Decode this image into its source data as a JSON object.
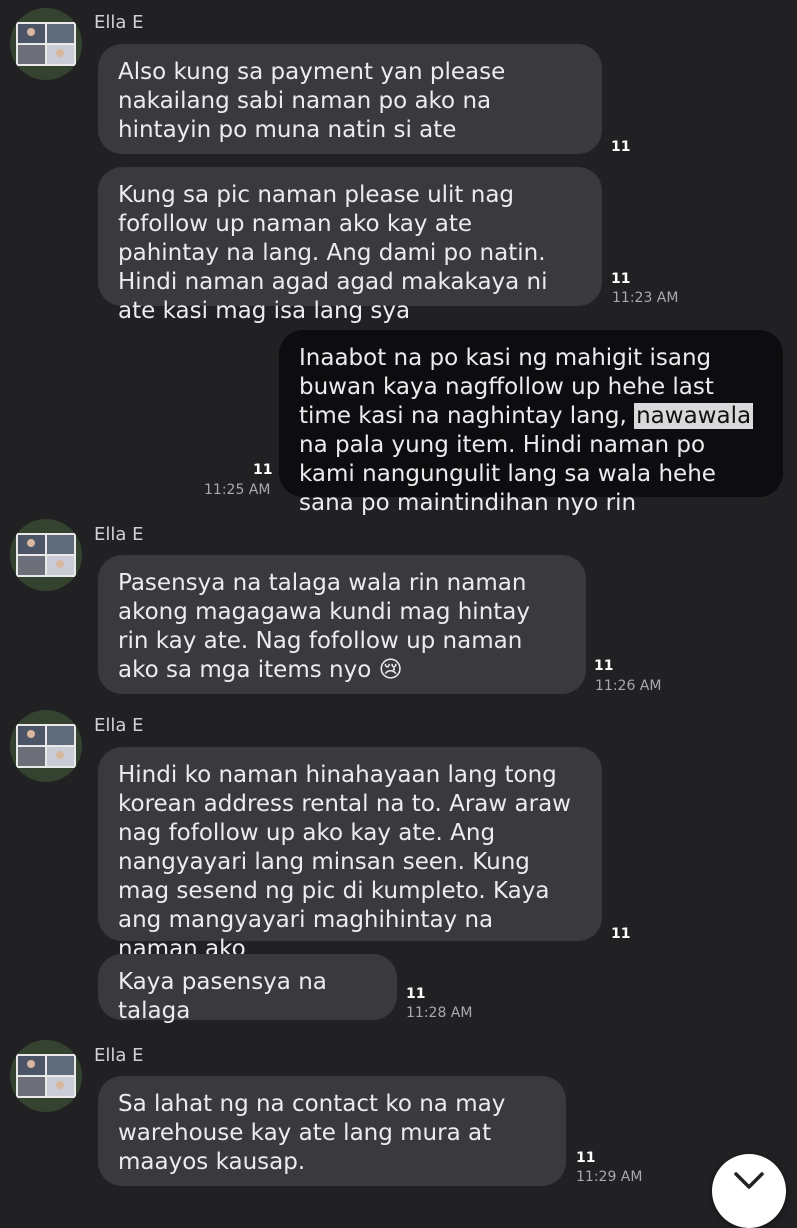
{
  "messages": [
    {
      "sender": "Ella E",
      "text": "Also kung sa payment yan please nakailang sabi naman po ako na hintayin po muna natin si ate",
      "unread": "11"
    },
    {
      "text": "Kung sa pic naman please ulit nag fofollow up naman ako kay ate pahintay na lang. Ang dami po natin. Hindi naman agad agad makakaya ni ate kasi mag isa lang sya",
      "unread": "11",
      "time": "11:23 AM"
    },
    {
      "outgoing": true,
      "text_before": "Inaabot na po kasi ng mahigit isang buwan kaya nagffollow up hehe last time kasi na naghintay lang, ",
      "highlight": "nawawala",
      "text_after": " na pala yung item. Hindi naman po kami nangungulit lang sa wala hehe sana po maintindihan nyo rin",
      "unread": "11",
      "time": "11:25 AM"
    },
    {
      "sender": "Ella E",
      "text": "Pasensya na talaga wala rin naman akong magagawa kundi mag hintay rin kay ate. Nag fofollow up naman ako sa mga items nyo",
      "emoji": "😢",
      "unread": "11",
      "time": "11:26 AM"
    },
    {
      "sender": "Ella E",
      "text": "Hindi ko naman hinahayaan lang tong korean address rental na to. Araw araw nag fofollow up ako kay ate. Ang nangyayari lang minsan seen. Kung mag sesend ng pic di kumpleto. Kaya ang mangyayari maghihintay na naman ako",
      "unread": "11"
    },
    {
      "text": "Kaya pasensya na talaga",
      "unread": "11",
      "time": "11:28 AM"
    },
    {
      "sender": "Ella E",
      "text": "Sa lahat ng na contact ko na may warehouse kay ate lang mura at maayos kausap.",
      "unread": "11",
      "time": "11:29 AM"
    }
  ],
  "icons": {
    "avatar": "profile-photo-icon",
    "scroll_down": "chevron-down-icon"
  },
  "colors": {
    "background": "#212124",
    "incoming_bubble": "#3a3a3e",
    "outgoing_bubble": "#0d0d0f"
  }
}
